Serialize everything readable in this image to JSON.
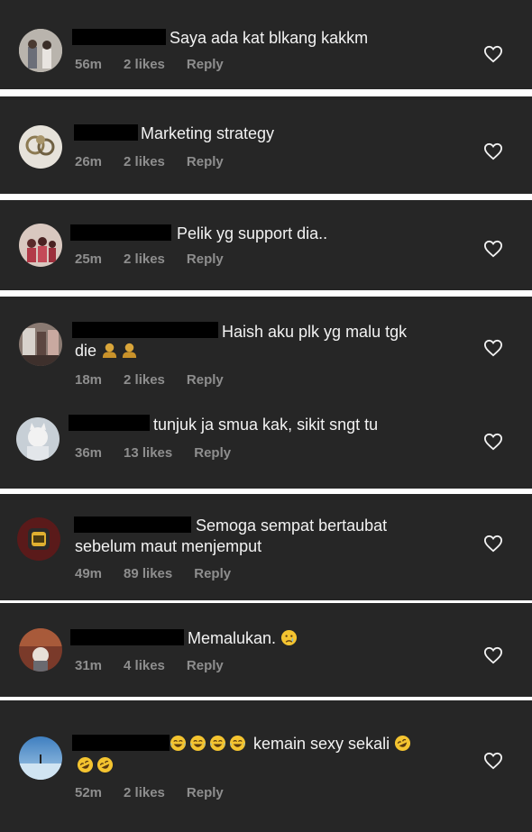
{
  "colors": {
    "card_bg": "#262626",
    "separator": "#ffffff",
    "text": "#f2f2f2",
    "meta": "#8e8e8e"
  },
  "comments": [
    {
      "text": "Saya ada kat blkang kakkm",
      "time": "56m",
      "likes": "2 likes",
      "reply": "Reply"
    },
    {
      "text": "Marketing strategy",
      "time": "26m",
      "likes": "2 likes",
      "reply": "Reply"
    },
    {
      "text": "Pelik yg support dia..",
      "time": "25m",
      "likes": "2 likes",
      "reply": "Reply"
    },
    {
      "text": "Haish aku plk yg malu tgk",
      "text_line2": "die",
      "emoji": "golden-bust-emoji",
      "time": "18m",
      "likes": "2 likes",
      "reply": "Reply"
    },
    {
      "text": "tunjuk ja smua kak,  sikit sngt tu",
      "time": "36m",
      "likes": "13 likes",
      "reply": "Reply"
    },
    {
      "text": "Semoga sempat bertaubat",
      "text_line2": "sebelum maut menjemput",
      "time": "49m",
      "likes": "89 likes",
      "reply": "Reply"
    },
    {
      "text": "Memalukan.",
      "emoji": "crying-face-emoji",
      "time": "31m",
      "likes": "4 likes",
      "reply": "Reply"
    },
    {
      "text": "kemain sexy sekali",
      "emoji": "laughing-emoji",
      "time": "52m",
      "likes": "2 likes",
      "reply": "Reply"
    }
  ],
  "icons": {
    "like": "heart-outline-icon"
  }
}
